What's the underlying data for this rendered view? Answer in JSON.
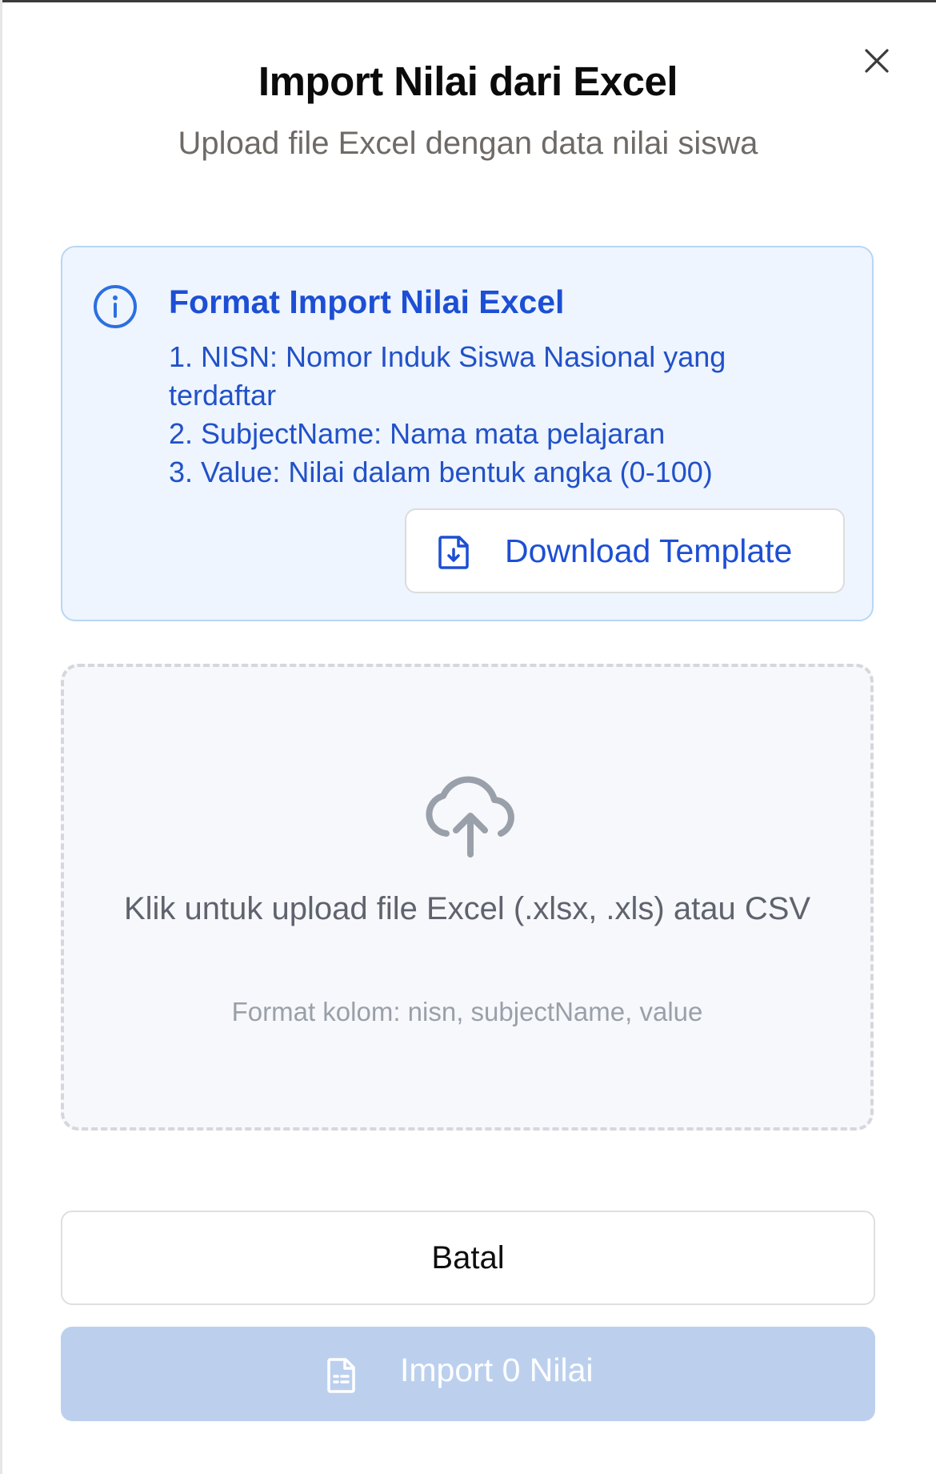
{
  "dialog": {
    "title": "Import Nilai dari Excel",
    "subtitle": "Upload file Excel dengan data nilai siswa",
    "close_icon": "close-icon"
  },
  "info": {
    "icon": "info-icon",
    "title": "Format Import Nilai Excel",
    "items": [
      "1. NISN: Nomor Induk Siswa Nasional yang terdaftar",
      "2. SubjectName: Nama mata pelajaran",
      "3. Value: Nilai dalam bentuk angka (0-100)"
    ],
    "download_button": {
      "icon": "file-download-icon",
      "label": "Download Template"
    }
  },
  "upload": {
    "icon": "cloud-upload-icon",
    "text": "Klik untuk upload file Excel (.xlsx, .xls) atau CSV",
    "hint": "Format kolom: nisn, subjectName, value"
  },
  "actions": {
    "cancel_label": "Batal",
    "import_label": "Import 0 Nilai",
    "import_icon": "spreadsheet-icon",
    "import_disabled": true
  },
  "colors": {
    "accent": "#1d4fd4",
    "info_bg": "#eef5fe",
    "info_border": "#b9d6f4",
    "disabled_button": "#bcd0ee",
    "upload_bg": "#f7f8fb"
  }
}
